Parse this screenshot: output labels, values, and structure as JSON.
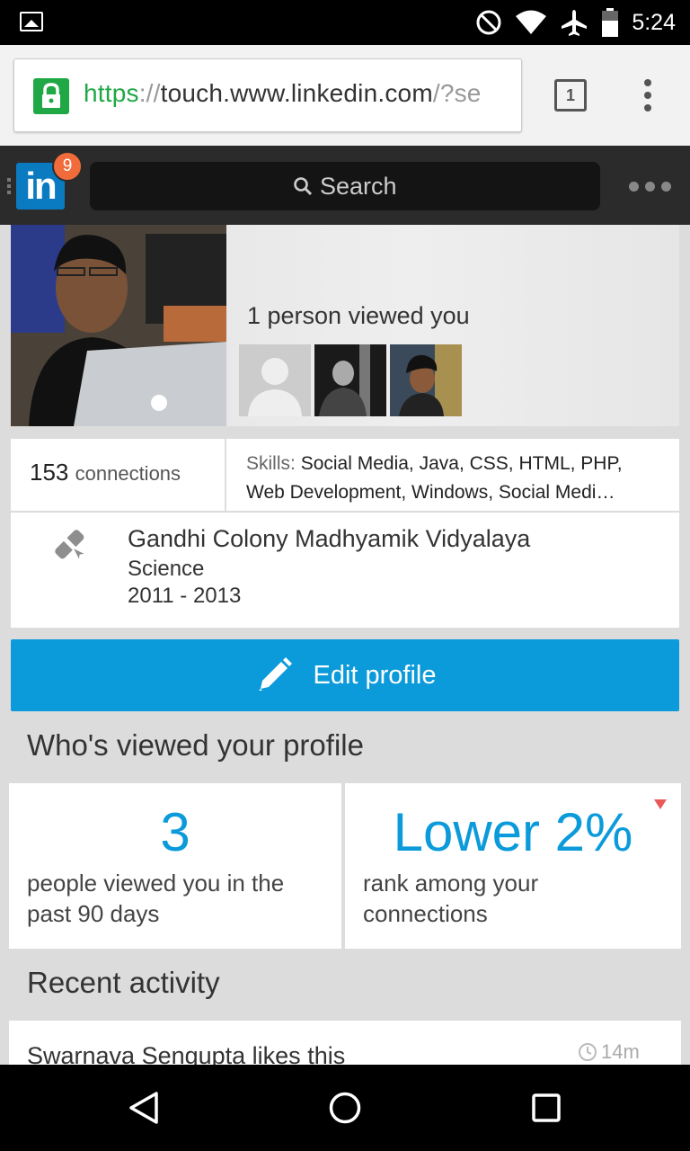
{
  "status_bar": {
    "time": "5:24",
    "icons": [
      "gallery-icon",
      "do-not-disturb-icon",
      "wifi-icon",
      "airplane-icon",
      "battery-icon"
    ]
  },
  "browser": {
    "url_scheme": "https",
    "url_sep": "://",
    "url_host": "touch.www.linkedin.com",
    "url_rest": "/?se",
    "tab_count": "1"
  },
  "header": {
    "logo": "in",
    "notification_count": "9",
    "search_label": "Search"
  },
  "profile": {
    "viewed_text": "1 person viewed you",
    "connections_count": "153",
    "connections_label": "connections",
    "skills_label": "Skills:",
    "skills_line1": "Social Media, Java, CSS, HTML, PHP,",
    "skills_line2": "Web Development, Windows, Social Medi…",
    "education": {
      "school": "Gandhi Colony Madhyamik Vidyalaya",
      "field": "Science",
      "years": "2011 - 2013"
    },
    "edit_label": "Edit profile"
  },
  "who_viewed": {
    "title": "Who's viewed your profile",
    "views_count": "3",
    "views_desc": "people viewed you in the past 90 days",
    "rank_value": "Lower 2%",
    "rank_desc": "rank among your connections"
  },
  "recent_activity": {
    "title": "Recent activity",
    "item_text": "Swarnava Sengupta likes this",
    "item_time": "14m"
  },
  "colors": {
    "linkedin_blue": "#0a7bc1",
    "accent_blue": "#0b9ada",
    "badge_orange": "#f26b3a",
    "secure_green": "#1fa845"
  }
}
